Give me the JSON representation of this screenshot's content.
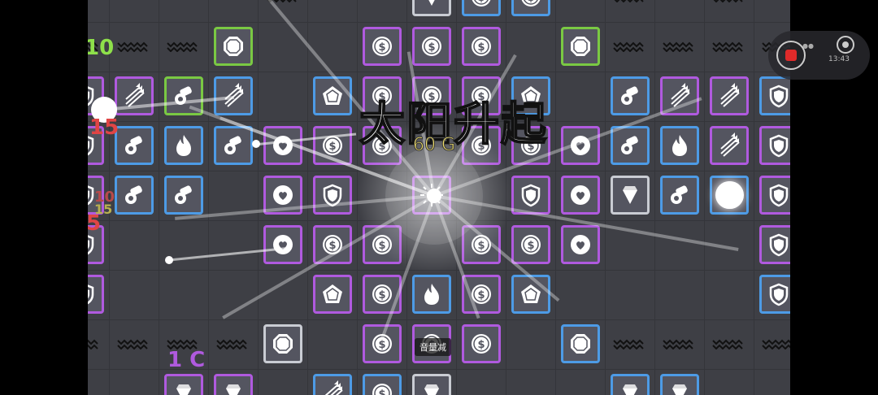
{
  "title": "太阳升起",
  "gold_text": "60 G",
  "toast_text": "音量减",
  "left_numbers": {
    "top": "10",
    "mid": "15",
    "low_a": "10",
    "low_b": "15",
    "low_c": "5"
  },
  "bottom_counter": "1 C",
  "recorder": {
    "time": "13:43"
  },
  "colors": {
    "purple": "#b05adf",
    "blue": "#4d9be6",
    "green": "#7ac943",
    "white": "#c9ccd3"
  },
  "icons": [
    "shield-icon",
    "coin-icon",
    "cannon-icon",
    "arrows-icon",
    "fire-icon",
    "pentagon-icon",
    "octagon-icon",
    "gem-icon",
    "heart-icon",
    "sun-icon"
  ]
}
